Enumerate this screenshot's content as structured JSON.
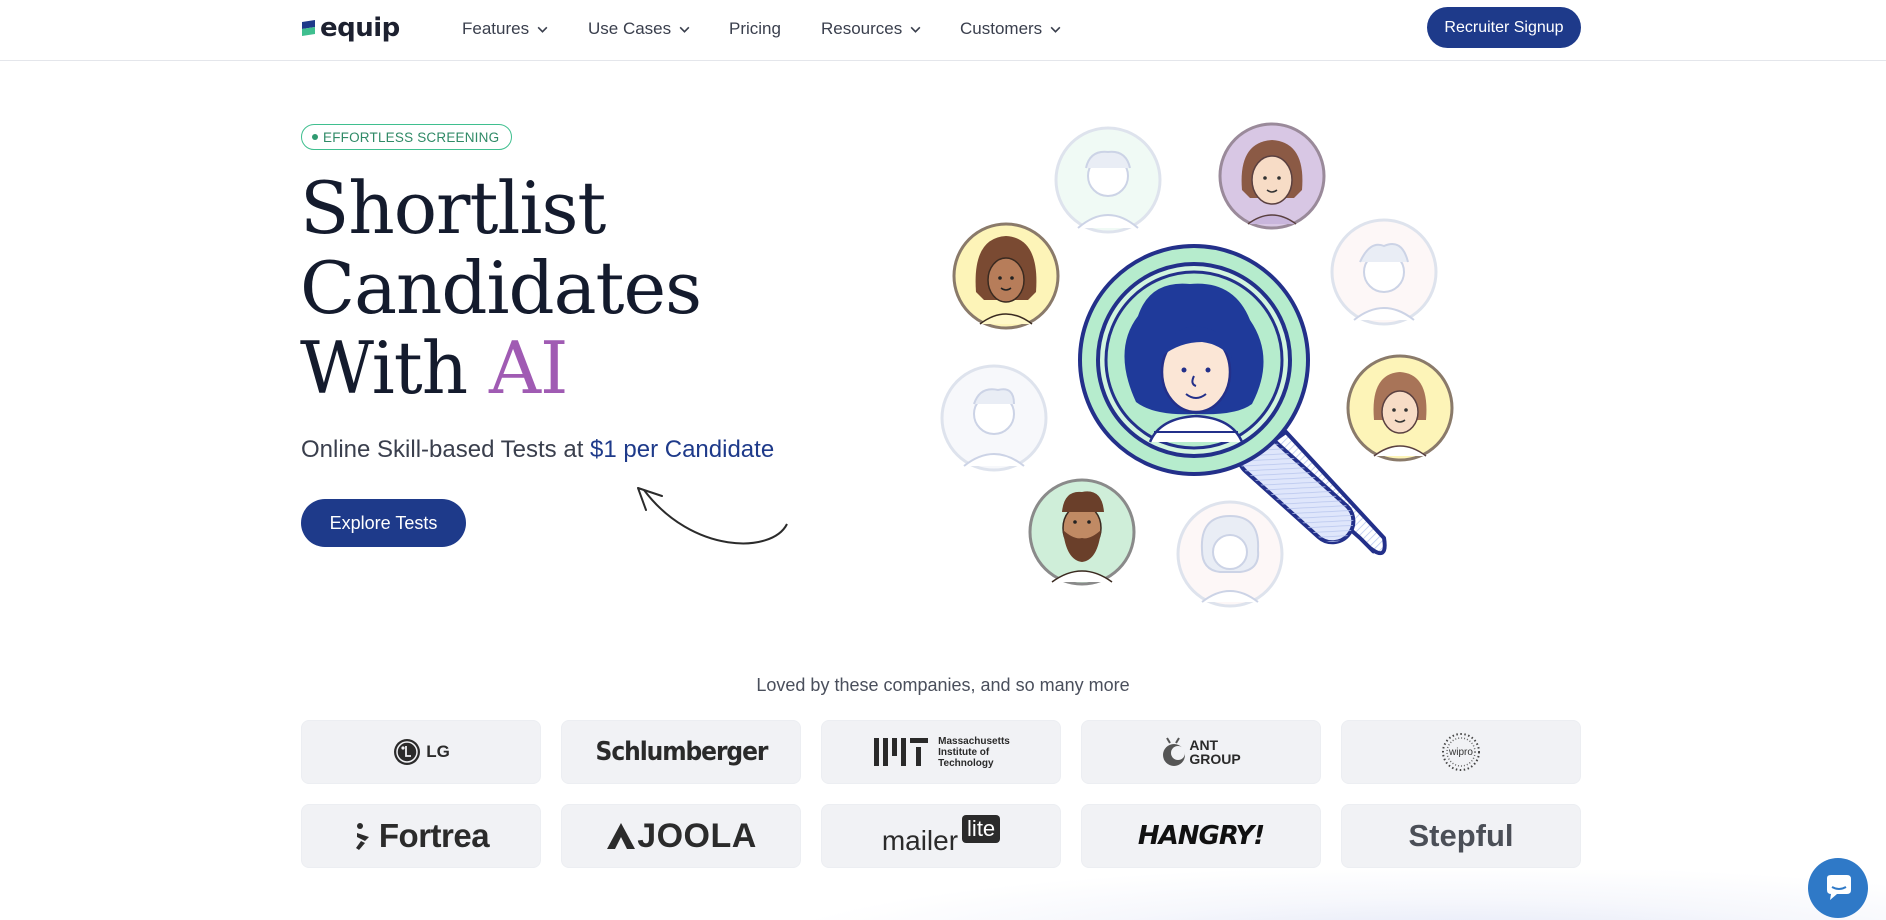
{
  "brand": {
    "name": "equip",
    "accent": "#1e3a8a",
    "green": "#3fbf8f",
    "purple": "#a05bb3"
  },
  "nav": {
    "items": [
      {
        "label": "Features",
        "dropdown": true
      },
      {
        "label": "Use Cases",
        "dropdown": true
      },
      {
        "label": "Pricing",
        "dropdown": false
      },
      {
        "label": "Resources",
        "dropdown": true
      },
      {
        "label": "Customers",
        "dropdown": true
      }
    ],
    "cta": "Recruiter Signup"
  },
  "hero": {
    "badge": "EFFORTLESS SCREENING",
    "headline_line1": "Shortlist",
    "headline_line2": "Candidates",
    "headline_line3_prefix": "With ",
    "headline_line3_accent": "AI",
    "subline_prefix": "Online Skill-based Tests at ",
    "subline_price": "$1 per Candidate",
    "cta": "Explore Tests"
  },
  "logos": {
    "title": "Loved by these companies, and so many more",
    "row1": {
      "lg": "LG",
      "schlumberger": "Schlumberger",
      "mit_line1": "Massachusetts",
      "mit_line2": "Institute of",
      "mit_line3": "Technology",
      "ant_line1": "ANT",
      "ant_line2": "GROUP",
      "wipro": "wipro"
    },
    "row2": {
      "fortrea": "Fortrea",
      "joola": "JOOLA",
      "mailer": "mailer",
      "lite": "lite",
      "hangry": "HANGRY!",
      "stepful": "Stepful"
    }
  },
  "icons": {
    "chat": "chat-bubble-icon",
    "chevron": "chevron-down-icon"
  }
}
